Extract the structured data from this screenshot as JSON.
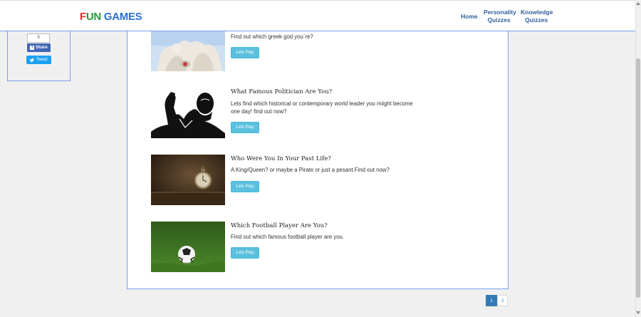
{
  "brand": {
    "fun": "FUN",
    "games": "GAMES",
    "colors": [
      "#e62e2e",
      "#1f9b3a",
      "#2b6fd6"
    ]
  },
  "nav": {
    "home": "Home",
    "personality_1": "Personality",
    "personality_2": "Quizzes",
    "knowledge_1": "Knowledge",
    "knowledge_2": "Quizzes"
  },
  "social": {
    "count": "0",
    "share": "Share",
    "tweet": "Tweet"
  },
  "quizzes": [
    {
      "title": "",
      "desc": "Find out which greek god you´re?",
      "button": "Lets Play",
      "image_icon": "greek-statue-image"
    },
    {
      "title": "What Famous Politician Are You?",
      "desc": "Lets find which historical or contemporary world leader you miight become one day! find out now?",
      "button": "Lets Play",
      "image_icon": "politician-silhouette-image"
    },
    {
      "title": "Who Were You In Your Past Life?",
      "desc": "A King/Queen? or maybe a Pirate or just a pesant.Find out now?",
      "button": "Lets Play",
      "image_icon": "clock-image"
    },
    {
      "title": "Which Football Player Are You?",
      "desc": "Find out which famous football player are you.",
      "button": "Lets Play",
      "image_icon": "football-image"
    }
  ],
  "pagination": [
    "1",
    "2"
  ],
  "colors": {
    "nav_link": "#2f5f9a",
    "button": "#5bc0de",
    "border": "#7a9ee8",
    "page_active": "#337ab7"
  }
}
